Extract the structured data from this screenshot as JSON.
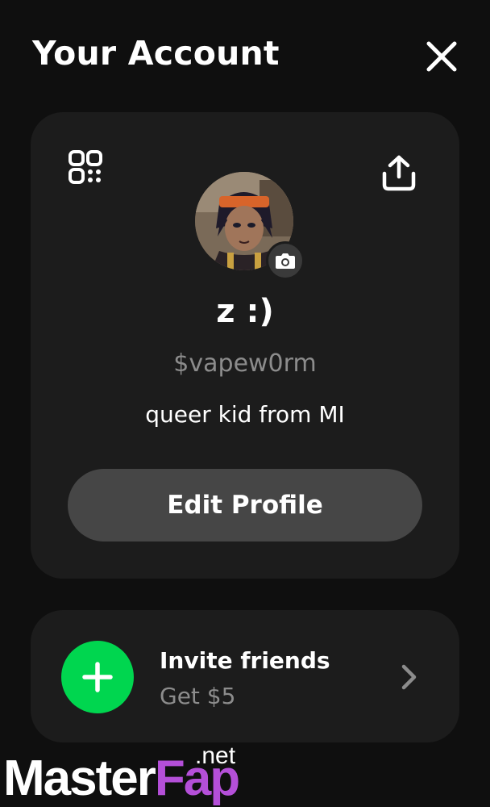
{
  "header": {
    "title": "Your Account",
    "close_icon": "close-icon"
  },
  "profile": {
    "qr_icon": "qr-code-icon",
    "share_icon": "share-icon",
    "avatar": "profile-avatar",
    "camera_icon": "camera-icon",
    "display_name": "z :)",
    "cashtag": "$vapew0rm",
    "bio": "queer kid from MI",
    "edit_label": "Edit Profile"
  },
  "invite": {
    "icon": "plus-icon",
    "title": "Invite friends",
    "subtitle": "Get $5",
    "chevron_icon": "chevron-right-icon",
    "accent": "#00d64f"
  },
  "watermark": {
    "part1": "Master",
    "part2": "Fap",
    "suffix": ".net",
    "accent": "#b44fd8"
  },
  "colors": {
    "background": "#0f0f0f",
    "card": "#1c1c1c",
    "button": "#464646",
    "muted_text": "#8c8c8c"
  }
}
